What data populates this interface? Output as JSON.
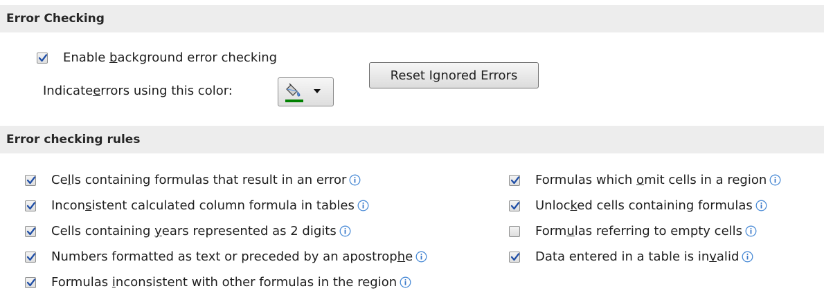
{
  "error_checking": {
    "header": "Error Checking",
    "enable_label": {
      "pre": "Enable ",
      "u": "b",
      "post": "ackground error checking"
    },
    "enable_checked": true,
    "indicate_label": {
      "pre": "Indicate ",
      "u": "e",
      "post": "rrors using this color:"
    },
    "indicator_color": "#008000",
    "reset_button": {
      "pre": "Reset I",
      "u": "g",
      "post": "nored Errors"
    }
  },
  "rules": {
    "header": "Error checking rules",
    "left": [
      {
        "pre": "Ce",
        "u": "l",
        "post": "ls containing formulas that result in an error",
        "checked": true
      },
      {
        "pre": "Incon",
        "u": "s",
        "post": "istent calculated column formula in tables",
        "checked": true
      },
      {
        "pre": "Cells containing ",
        "u": "y",
        "post": "ears represented as 2 digits",
        "checked": true
      },
      {
        "pre": "Numbers formatted as text or preceded by an apostrop",
        "u": "h",
        "post": "e",
        "checked": true
      },
      {
        "pre": "Formulas ",
        "u": "i",
        "post": "nconsistent with other formulas in the region",
        "checked": true
      }
    ],
    "right": [
      {
        "pre": "Formulas which ",
        "u": "o",
        "post": "mit cells in a region",
        "checked": true
      },
      {
        "pre": "Unloc",
        "u": "k",
        "post": "ed cells containing formulas",
        "checked": true
      },
      {
        "pre": "Form",
        "u": "u",
        "post": "las referring to empty cells",
        "checked": false
      },
      {
        "pre": "Data entered in a table is in",
        "u": "v",
        "post": "alid",
        "checked": true
      }
    ]
  }
}
